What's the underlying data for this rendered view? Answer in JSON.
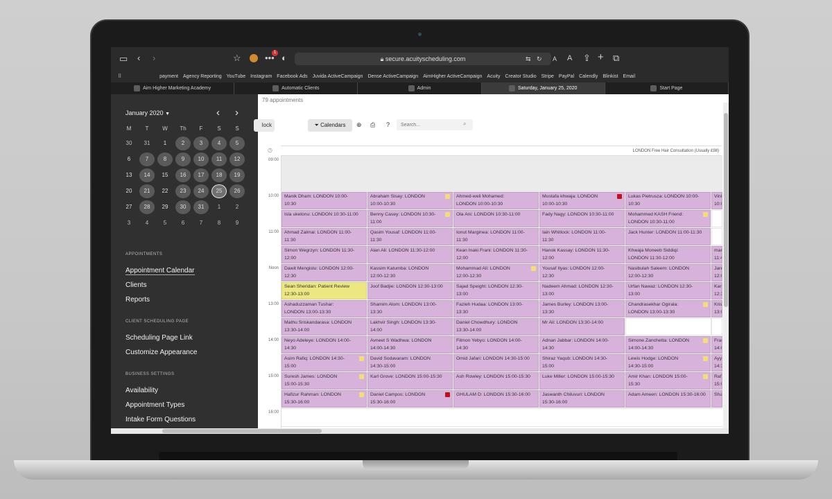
{
  "browser": {
    "url": "secure.acuityscheduling.com",
    "bookmarks": [
      "payment",
      "Agency Reporting",
      "YouTube",
      "Instagram",
      "Facebook Ads",
      "Juvida ActiveCampaign",
      "Dense ActiveCampaign",
      "AimHigher ActiveCampaign",
      "Acuity",
      "Creator Studio",
      "Stripe",
      "PayPal",
      "Calendly",
      "Blinkist",
      "Email"
    ],
    "tabs": [
      {
        "label": "Aim Higher Marketing Academy",
        "active": false
      },
      {
        "label": "Automatic Clients",
        "active": false
      },
      {
        "label": "Admin",
        "active": false
      },
      {
        "label": "Saturday, January 25, 2020",
        "active": true
      },
      {
        "label": "Start Page",
        "active": false
      }
    ],
    "notification_count": "1",
    "reader_a_small": "A",
    "reader_a_large": "A"
  },
  "sidebar": {
    "month_label": "January 2020",
    "weekdays": [
      "M",
      "T",
      "W",
      "Th",
      "F",
      "S",
      "S"
    ],
    "weeks": [
      [
        "30",
        "31",
        "1",
        "2",
        "3",
        "4",
        "5"
      ],
      [
        "6",
        "7",
        "8",
        "9",
        "10",
        "11",
        "12"
      ],
      [
        "13",
        "14",
        "15",
        "16",
        "17",
        "18",
        "19"
      ],
      [
        "20",
        "21",
        "22",
        "23",
        "24",
        "25",
        "26"
      ],
      [
        "27",
        "28",
        "29",
        "30",
        "31",
        "1",
        "2"
      ],
      [
        "3",
        "4",
        "5",
        "6",
        "7",
        "8",
        "9"
      ]
    ],
    "section_appointments": "APPOINTMENTS",
    "appointment_links": [
      "Appointment Calendar",
      "Clients",
      "Reports"
    ],
    "section_client_scheduling": "CLIENT SCHEDULING PAGE",
    "client_links": [
      "Scheduling Page Link",
      "Customize Appearance"
    ],
    "section_business": "BUSINESS SETTINGS",
    "business_links": [
      "Availability",
      "Appointment Types",
      "Intake Form Questions"
    ]
  },
  "main": {
    "appointment_count": "79 appointments",
    "block_button": "lock",
    "calendars_button": "Calendars",
    "help_label": "?",
    "search_placeholder": "Search...",
    "calendar_header": "LONDON Free Hair Consultation (Usually £98)",
    "time_labels": [
      "09:00",
      "10:00",
      "11:00",
      "Noon",
      "13:00",
      "14:00",
      "15:00",
      "16:00"
    ]
  },
  "colors": {
    "appointment": "#d7b3dc",
    "patient_review": "#ece781",
    "badge_yellow": "#f4dc7a",
    "badge_red": "#c40e1e",
    "sidebar_bg": "#303030"
  },
  "appointments": [
    {
      "col": 0,
      "row": 0,
      "l1": "Manik Dham:  LONDON  10:00-",
      "l2": "10:30"
    },
    {
      "col": 0,
      "row": 1,
      "l1": "Isla ukelonu:  LONDON  10:30-11:00",
      "l2": ""
    },
    {
      "col": 0,
      "row": 2,
      "l1": "Ahmad Zalmai:  LONDON  11:00-",
      "l2": "11:30"
    },
    {
      "col": 0,
      "row": 3,
      "l1": "Simon Wegrzyn:  LONDON  11:30-",
      "l2": "12:00"
    },
    {
      "col": 0,
      "row": 4,
      "l1": "Dawit Mengistu:  LONDON  12:00-",
      "l2": "12:30"
    },
    {
      "col": 0,
      "row": 5,
      "l1": "Sean Sheridan:  Patient Review",
      "l2": "12:30-13:00",
      "style": "yellow"
    },
    {
      "col": 0,
      "row": 6,
      "l1": "Ashaduzzaman Tushar:",
      "l2": "LONDON  13:00-13:30"
    },
    {
      "col": 0,
      "row": 7,
      "l1": "Mathu Sriskandarasa:  LONDON",
      "l2": "13:30-14:00"
    },
    {
      "col": 0,
      "row": 8,
      "l1": "Neyo Adeleye:  LONDON  14:00-",
      "l2": "14:30"
    },
    {
      "col": 0,
      "row": 9,
      "l1": "Asim Rafiq:  LONDON  14:30-",
      "l2": "15:00",
      "badge": "yellow"
    },
    {
      "col": 0,
      "row": 10,
      "l1": "Suresh James:  LONDON",
      "l2": "15:00-15:30",
      "badge": "yellow"
    },
    {
      "col": 0,
      "row": 11,
      "l1": "Hafizur Rahman:  LONDON",
      "l2": "15:30-16:00",
      "badge": "yellow"
    },
    {
      "col": 1,
      "row": 0,
      "l1": "Abraham Sisay:  LONDON",
      "l2": "10:00-10:30",
      "badge": "yellow"
    },
    {
      "col": 1,
      "row": 1,
      "l1": "Benny Casey:  LONDON  10:30-",
      "l2": "11:00",
      "badge": "yellow"
    },
    {
      "col": 1,
      "row": 2,
      "l1": "Qasim Yousaf:  LONDON  11:00-",
      "l2": "11:30"
    },
    {
      "col": 1,
      "row": 3,
      "l1": "Alan Ali:  LONDON  11:30-12:00",
      "l2": ""
    },
    {
      "col": 1,
      "row": 4,
      "l1": "Kassim Katumba:  LONDON",
      "l2": "12:00-12:30"
    },
    {
      "col": 1,
      "row": 5,
      "l1": "Joof Badjie:  LONDON  12:30-13:00",
      "l2": ""
    },
    {
      "col": 1,
      "row": 6,
      "l1": "Shamim Alom:  LONDON  13:00-",
      "l2": "13:30"
    },
    {
      "col": 1,
      "row": 7,
      "l1": "Lakhvir Singh:  LONDON  13:30-",
      "l2": "14:00"
    },
    {
      "col": 1,
      "row": 8,
      "l1": "Avneet S Wadhwa:  LONDON",
      "l2": "14:00-14:30"
    },
    {
      "col": 1,
      "row": 9,
      "l1": "David Sodavaram:  LONDON",
      "l2": "14:30-15:00"
    },
    {
      "col": 1,
      "row": 10,
      "l1": "Karl Grove:  LONDON  15:00-15:30",
      "l2": ""
    },
    {
      "col": 1,
      "row": 11,
      "l1": "Daniel Campos:  LONDON",
      "l2": "15:30-16:00",
      "badge": "red"
    },
    {
      "col": 2,
      "row": 0,
      "l1": "Ahmed-weli Mohamed:",
      "l2": "LONDON  10:00-10:30"
    },
    {
      "col": 2,
      "row": 1,
      "l1": "Ola Ani:  LONDON  10:30-11:00",
      "l2": ""
    },
    {
      "col": 2,
      "row": 2,
      "l1": "Ionut Marginea:  LONDON  11:00-",
      "l2": "11:30"
    },
    {
      "col": 2,
      "row": 3,
      "l1": "Kean Inaki Frani:  LONDON  11:30-",
      "l2": "12:00"
    },
    {
      "col": 2,
      "row": 4,
      "l1": "Mohammad Ali:  LONDON",
      "l2": "12:00-12:30",
      "badge": "yellow"
    },
    {
      "col": 2,
      "row": 5,
      "l1": "Sajad Speight:  LONDON  12:30-",
      "l2": "13:00"
    },
    {
      "col": 2,
      "row": 6,
      "l1": "Fazleh Hudaa:  LONDON  13:00-",
      "l2": "13:30"
    },
    {
      "col": 2,
      "row": 7,
      "l1": "Daniel Chowdhury:  LONDON",
      "l2": "13:30-14:00"
    },
    {
      "col": 2,
      "row": 8,
      "l1": "Filmon Yebyo:  LONDON  14:00-",
      "l2": "14:30"
    },
    {
      "col": 2,
      "row": 9,
      "l1": "Omid Jafari:  LONDON  14:30-15:00",
      "l2": ""
    },
    {
      "col": 2,
      "row": 10,
      "l1": "Ash Rowley:  LONDON  15:00-15:30",
      "l2": ""
    },
    {
      "col": 2,
      "row": 11,
      "l1": "GHULAM D:  LONDON  15:30-16:00",
      "l2": ""
    },
    {
      "col": 3,
      "row": 0,
      "l1": "Mustafa khwaja:  LONDON",
      "l2": "10:00-10:30",
      "badge": "red"
    },
    {
      "col": 3,
      "row": 1,
      "l1": "Fady Nagy:  LONDON  10:30-11:00",
      "l2": ""
    },
    {
      "col": 3,
      "row": 2,
      "l1": "Iain Whitlock:  LONDON  11:00-",
      "l2": "11:30"
    },
    {
      "col": 3,
      "row": 3,
      "l1": "Hanok Kassay:  LONDON  11:30-",
      "l2": "12:00"
    },
    {
      "col": 3,
      "row": 4,
      "l1": "Yousaf Ilyas:  LONDON  12:00-",
      "l2": "12:30"
    },
    {
      "col": 3,
      "row": 5,
      "l1": "Nadeem Ahmad:  LONDON  12:30-",
      "l2": "13:00"
    },
    {
      "col": 3,
      "row": 6,
      "l1": "James Burley:  LONDON  13:00-",
      "l2": "13:30"
    },
    {
      "col": 3,
      "row": 7,
      "l1": "Mr Ali:  LONDON  13:30-14:00",
      "l2": ""
    },
    {
      "col": 3,
      "row": 8,
      "l1": "Adnan Jabbar:  LONDON  14:00-",
      "l2": "14:30"
    },
    {
      "col": 3,
      "row": 9,
      "l1": "Shiraz Yaqub:  LONDON  14:30-",
      "l2": "15:00"
    },
    {
      "col": 3,
      "row": 10,
      "l1": "Luke Miller:  LONDON  15:00-15:30",
      "l2": ""
    },
    {
      "col": 3,
      "row": 11,
      "l1": "Jaswanth Chiluvuri:  LONDON",
      "l2": "15:30-16:00"
    },
    {
      "col": 4,
      "row": 0,
      "l1": "Lukas Pietrusza:  LONDON  10:00-",
      "l2": "10:30"
    },
    {
      "col": 4,
      "row": 1,
      "l1": "Mohammed KASH Friend:",
      "l2": "LONDON  10:30-11:00",
      "badge": "yellow"
    },
    {
      "col": 4,
      "row": 2,
      "l1": "Jack Hunter:  LONDON  11:00-11:30",
      "l2": ""
    },
    {
      "col": 4,
      "row": 3,
      "l1": "Khwaja Moneeb Siddiqi:",
      "l2": "LONDON  11:30-12:00"
    },
    {
      "col": 4,
      "row": 4,
      "l1": "Nasibulah Saleem:  LONDON",
      "l2": "12:00-12:30"
    },
    {
      "col": 4,
      "row": 5,
      "l1": "Urfan Nawaz:  LONDON  12:30-",
      "l2": "13:00"
    },
    {
      "col": 4,
      "row": 6,
      "l1": "Chandrasekhar Ogirala:",
      "l2": "LONDON  13:00-13:30",
      "badge": "yellow"
    },
    {
      "col": 4,
      "row": 7,
      "l1": "",
      "l2": "",
      "style": "white"
    },
    {
      "col": 4,
      "row": 8,
      "l1": "Simone Zanchetta:  LONDON",
      "l2": "14:00-14:30",
      "badge": "yellow"
    },
    {
      "col": 4,
      "row": 9,
      "l1": "Lewis Hodge:  LONDON",
      "l2": "14:30-15:00",
      "badge": "yellow"
    },
    {
      "col": 4,
      "row": 10,
      "l1": "Amir Khan:  LONDON  15:00-",
      "l2": "15:30",
      "badge": "yellow"
    },
    {
      "col": 4,
      "row": 11,
      "l1": "Adam Ameen:  LONDON  15:30-16:00",
      "l2": ""
    },
    {
      "col": 5,
      "row": 0,
      "l1": "Vinit",
      "l2": "10:0"
    },
    {
      "col": 5,
      "row": 1,
      "l1": "",
      "l2": "",
      "style": "white"
    },
    {
      "col": 5,
      "row": 2,
      "l1": "",
      "l2": "",
      "style": "white"
    },
    {
      "col": 5,
      "row": 3,
      "l1": "mar",
      "l2": "11:4"
    },
    {
      "col": 5,
      "row": 4,
      "l1": "Jare",
      "l2": "12:0"
    },
    {
      "col": 5,
      "row": 5,
      "l1": "Karl",
      "l2": "12:3"
    },
    {
      "col": 5,
      "row": 6,
      "l1": "Krist",
      "l2": "13:0"
    },
    {
      "col": 5,
      "row": 7,
      "l1": "",
      "l2": "",
      "style": "white"
    },
    {
      "col": 5,
      "row": 8,
      "l1": "Fran",
      "l2": "14:0"
    },
    {
      "col": 5,
      "row": 9,
      "l1": "Ayy",
      "l2": "14:3"
    },
    {
      "col": 5,
      "row": 10,
      "l1": "Rafiq",
      "l2": "15:0"
    },
    {
      "col": 5,
      "row": 11,
      "l1": "Sha",
      "l2": ""
    }
  ]
}
